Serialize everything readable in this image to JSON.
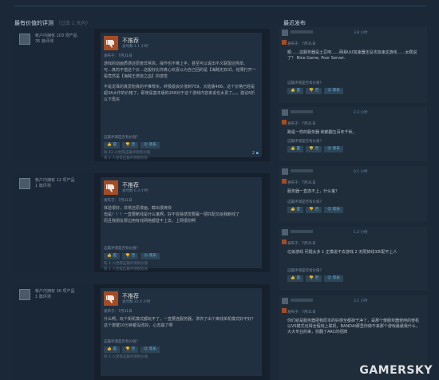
{
  "headers": {
    "left_title": "最有价值的评测",
    "left_sub": "（过去 1 天内）",
    "right_title": "最近发布"
  },
  "reviews": [
    {
      "owns": "帐户内拥有 103 项产品",
      "reviews": "35 篇评测",
      "verdict": "不推荐",
      "hours": "总时数 1.1 小时",
      "posted": "发布于：7月31日",
      "lines": [
        "游戏的动画质感还原度非常高，操作也不难上手，甚至可以说出不义联盟还简单。",
        "可…真的不值这个价…这般好比你真心欢喜以为自己回的是【海贼无双3】，结果打开一看竟然是【海贼王燃烧之血】的感觉",
        "",
        "不是龙珠的真爱粉真的不推荐买，终极版会价涨到759，大陆版468，这个价格已经是超3A大作的价格了，即使是基本版的268对于这个游戏内容来说也太贵了。。。建议6折以下再买"
      ],
      "helpful_q": "这篇评测是否有价值？",
      "yes": "是",
      "no": "否",
      "funny": "欢乐",
      "votes1": "有 43 人觉得这篇评测有价值",
      "votes2": "有 2 人觉得这篇评测很欢乐",
      "comments": "2"
    },
    {
      "owns": "帐户内拥有 12 项产品",
      "reviews": "1 篇评测",
      "verdict": "不推荐",
      "hours": "总时数 0.3 小时",
      "posted": "发布于：7月31日",
      "lines": [
        "体验很好，非常还原漫画，截出很爽快",
        "但是！！！一直要断线是什么鬼啊，好不容易感觉要赢一把匹配又给我断线了",
        "而且我朋友那边用有线网络都登不上去，上网很别啊"
      ],
      "helpful_q": "这篇评测是否有价值？",
      "yes": "是",
      "no": "否",
      "funny": "欢乐",
      "votes1": "有 2 人觉得这篇评测有价值",
      "votes2": "有 1 人觉得这篇评测很欢乐",
      "comments": ""
    },
    {
      "owns": "帐户内拥有 36 项产品",
      "reviews": "1 篇评测",
      "verdict": "不推荐",
      "hours": "总时数 22.4 小时",
      "posted": "发布于：7月31日",
      "lines": [
        "什么啊，玩个街机模式都玩不了，一直要连服务器，求你了出个离线单机模式好不好？这个按键10分钟都没改好，心态崩了啊"
      ],
      "helpful_q": "这篇评测是否有价值？",
      "yes": "是",
      "no": "否",
      "funny": "欢乐",
      "votes1": "有 2 人觉得这篇评测有价值",
      "votes2": "",
      "comments": ""
    }
  ],
  "recent": [
    {
      "hours": "3.8 小时",
      "date": "发布于：7月31日",
      "text": "额……这服务器是土豆吧……网易UU加速器还没法加速这游戏……太瞎说了？ Nice Game, Poor Server."
    },
    {
      "hours": "2.3 小时",
      "date": "发布于：7月31日",
      "text": "跑是一样的服务器 和鹅翻五百年千秋。"
    },
    {
      "hours": "0.1 小时",
      "date": "发布于：7月31日",
      "text": "服务器一直连不上，什么鬼？"
    },
    {
      "hours": "1.2 小时",
      "date": "发布于：7月31日",
      "text": "垃圾游戏 问题太多 1 正模说不去游戏 2 无限掉线3匹配不上人"
    },
    {
      "hours": "3.1 小时",
      "date": "发布于：7月31日",
      "text": "你们就是服务器把我原本的好感全都抹干净了，是那个傻服务器使用的使机以VS模式也得全程线上联机，BANDAI那里你做不来那个游戏最最我什么，大大专业的来，别翻了ARC的招牌"
    }
  ],
  "helpful_q": "这篇评测是否有价值？",
  "yes": "是",
  "no": "否",
  "funny": "欢乐",
  "watermark": "GAMERSKY",
  "colors": {
    "bg": "#1b2838",
    "thumb_down": "#a34c25",
    "accent": "#66c0f4"
  }
}
